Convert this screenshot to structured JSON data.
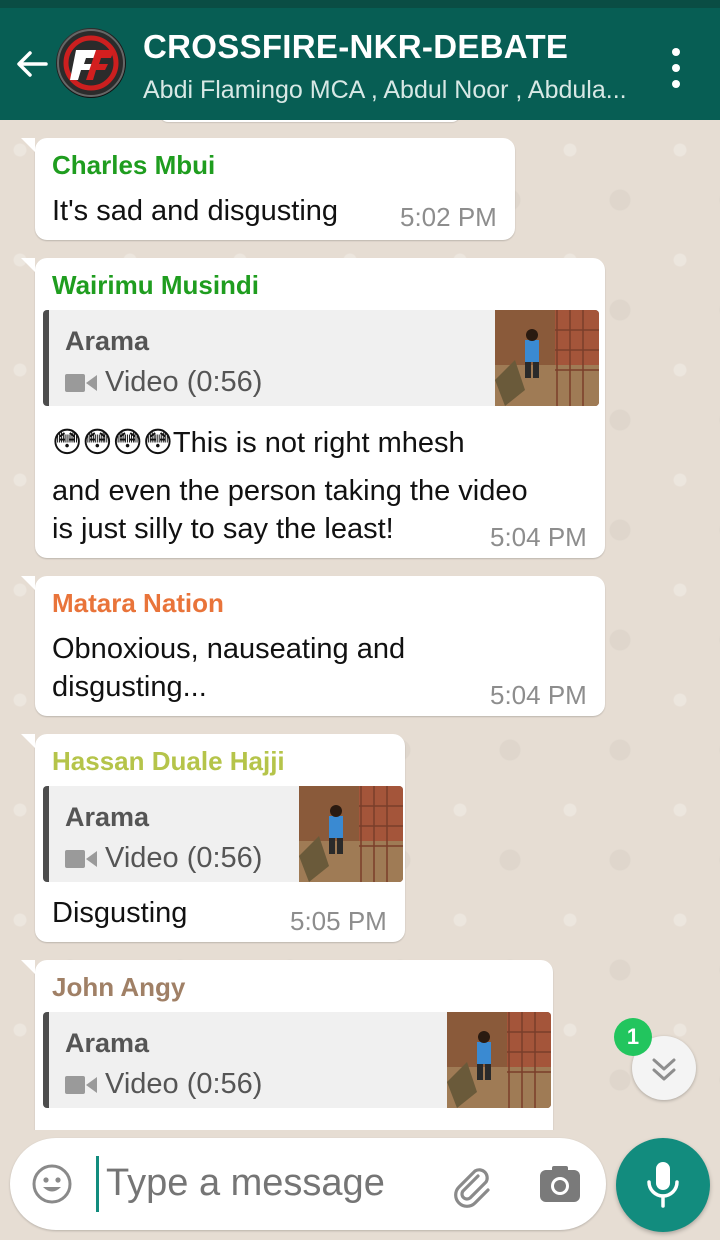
{
  "header": {
    "title": "CROSSFIRE-NKR-DEBATE",
    "subtitle": "Abdi Flamingo MCA , Abdul Noor , Abdula...",
    "avatar_logo_text": "CF"
  },
  "messages": [
    {
      "sender": "Charles Mbui",
      "sender_color": "#1f9d1f",
      "line1": "It's sad and disgusting",
      "time": "5:02 PM"
    },
    {
      "sender": "Wairimu Musindi",
      "sender_color": "#1f9d1f",
      "quote": {
        "name": "Arama",
        "video": "Video (0:56)"
      },
      "line1": "😳😳😳😳This is not right mhesh",
      "line2": "and even the person taking the video",
      "line3": "is just silly to say the least!",
      "time": "5:04 PM"
    },
    {
      "sender": "Matara Nation",
      "sender_color": "#e9743a",
      "line1": "Obnoxious, nauseating and",
      "line2": "disgusting...",
      "time": "5:04 PM"
    },
    {
      "sender": "Hassan Duale Hajji",
      "sender_color": "#b5c44a",
      "quote": {
        "name": "Arama",
        "video": "Video (0:56)"
      },
      "line1": "Disgusting",
      "time": "5:05 PM"
    },
    {
      "sender": "John Angy",
      "sender_color": "#a08066",
      "quote": {
        "name": "Arama",
        "video": "Video (0:56)"
      }
    }
  ],
  "composer": {
    "placeholder": "Type a message"
  },
  "unread_count": "1",
  "icons": [
    "back-arrow-icon",
    "more-vert-icon",
    "video-camera-icon",
    "emoji-icon",
    "attach-icon",
    "camera-icon",
    "mic-icon",
    "double-chevron-down-icon"
  ]
}
